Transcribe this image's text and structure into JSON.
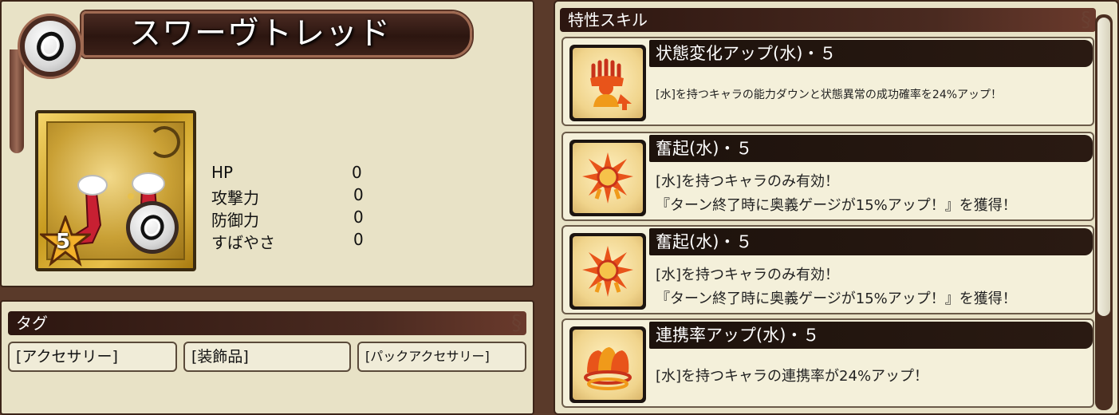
{
  "equipment": {
    "name": "スワーヴトレッド",
    "rarity": "5",
    "element_icon": "ring-icon",
    "stats": [
      {
        "label": "HP",
        "value": "0"
      },
      {
        "label": "攻撃力",
        "value": "0"
      },
      {
        "label": "防御力",
        "value": "0"
      },
      {
        "label": "すばやさ",
        "value": "0"
      }
    ]
  },
  "tags": {
    "title": "タグ",
    "items": [
      "[アクセサリー]",
      "[装飾品]",
      "[パックアクセサリー]"
    ]
  },
  "skills": {
    "title": "特性スキル",
    "items": [
      {
        "name": "状態変化アップ(水)・５",
        "icon": "hand-flame-icon",
        "desc": [
          "[水]を持つキャラの能力ダウンと状態異常の成功確率を24%アップ！"
        ]
      },
      {
        "name": "奮起(水)・５",
        "icon": "burst-arrow-icon",
        "desc": [
          "[水]を持つキャラのみ有効！",
          "『ターン終了時に奥義ゲージが15%アップ！』を獲得！"
        ]
      },
      {
        "name": "奮起(水)・５",
        "icon": "burst-arrow-icon",
        "desc": [
          "[水]を持つキャラのみ有効！",
          "『ターン終了時に奥義ゲージが15%アップ！』を獲得！"
        ]
      },
      {
        "name": "連携率アップ(水)・５",
        "icon": "chain-flame-icon",
        "desc": [
          "[水]を持つキャラの連携率が24%アップ！"
        ]
      }
    ]
  },
  "colors": {
    "panel_bg": "#e8e2c6",
    "header_dark": "#2c1610",
    "border_brown": "#3b2418",
    "icon_orange": "#e8541a"
  }
}
